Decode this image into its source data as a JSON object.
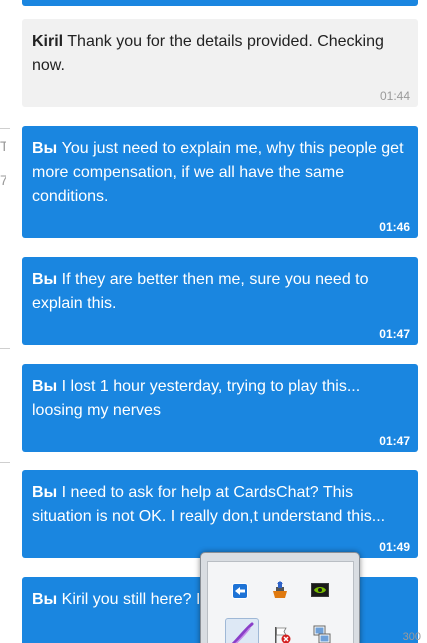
{
  "messages": [
    {
      "author": "",
      "text": "",
      "time": "",
      "outgoing": true
    },
    {
      "author": "Kiril",
      "text": " Thank you for the details provided. Checking now.",
      "time": "01:44",
      "outgoing": false
    },
    {
      "author": "Вы",
      "text": " You just need to explain me, why this people get more compensation, if we all have the same conditions.",
      "time": "01:46",
      "outgoing": true
    },
    {
      "author": "Вы",
      "text": " If they are better then me, sure you need to explain this.",
      "time": "01:47",
      "outgoing": true
    },
    {
      "author": "Вы",
      "text": " I lost 1 hour yesterday, trying to play this... loosing my nerves",
      "time": "01:47",
      "outgoing": true
    },
    {
      "author": "Вы",
      "text": " I need to ask for help at CardsChat? This situation is not OK. I really don,t understand this...",
      "time": "01:49",
      "outgoing": true
    },
    {
      "author": "Вы",
      "text": " Kiril you still here? I",
      "time": "",
      "outgoing": true
    }
  ],
  "edge_marks": [
    "T",
    "7"
  ],
  "tray_icons": [
    "teamviewer-icon",
    "java-update-icon",
    "nvidia-icon",
    "pen-tablet-icon",
    "action-center-flag-icon",
    "network-icon"
  ],
  "colors": {
    "outgoing_bubble": "#1a86e0",
    "incoming_bubble": "#f1f1f1"
  },
  "bottom_number": "300"
}
